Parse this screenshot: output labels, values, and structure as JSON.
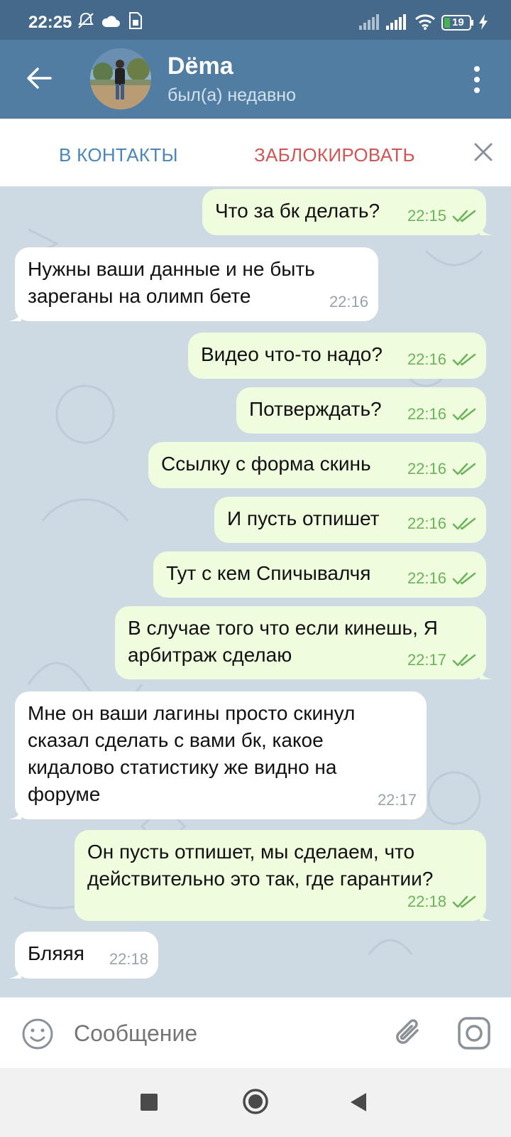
{
  "status_bar": {
    "time": "22:25",
    "icons": [
      "mute-icon",
      "cloud-icon",
      "sim-card-icon",
      "signal-icon",
      "signal-icon",
      "wifi-icon",
      "battery-icon",
      "charging-icon"
    ],
    "battery": "19"
  },
  "header": {
    "name": "Dёma",
    "status": "был(а) недавно"
  },
  "actions": {
    "add_contact": "В КОНТАКТЫ",
    "block": "ЗАБЛОКИРОВАТЬ"
  },
  "messages": [
    {
      "dir": "out",
      "text": "Что за бк делать?",
      "time": "22:15"
    },
    {
      "dir": "in",
      "text": "Нужны ваши данные и не быть\nзареганы на олимп бете",
      "time": "22:16"
    },
    {
      "dir": "out",
      "text": "Видео что-то надо?",
      "time": "22:16"
    },
    {
      "dir": "out",
      "text": "Потверждать?",
      "time": "22:16"
    },
    {
      "dir": "out",
      "text": "Ссылку с форма скинь",
      "time": "22:16"
    },
    {
      "dir": "out",
      "text": "И пусть отпишет",
      "time": "22:16"
    },
    {
      "dir": "out",
      "text": "Тут с кем Спичывалчя",
      "time": "22:16"
    },
    {
      "dir": "out",
      "text": "В случае того что если кинешь, Я\nарбитраж сделаю",
      "time": "22:17"
    },
    {
      "dir": "in",
      "text": "Мне он ваши лагины просто скинул\nсказал сделать с вами бк, какое\nкидалово статистику же видно на\nфоруме",
      "time": "22:17"
    },
    {
      "dir": "out",
      "text": "Он пусть отпишет, мы сделаем, что\nдействительно это так, где гарантии?",
      "time": "22:18"
    },
    {
      "dir": "in",
      "text": "Бляяя",
      "time": "22:18"
    }
  ],
  "input": {
    "placeholder": "Сообщение"
  },
  "colors": {
    "header": "#527da3",
    "status_bar": "#45698a",
    "outgoing_bubble": "#effdde",
    "incoming_bubble": "#ffffff",
    "chat_background": "#cdd9e3",
    "add_contact": "#4a86b8",
    "block": "#cf5655",
    "tick": "#6bb35a"
  }
}
